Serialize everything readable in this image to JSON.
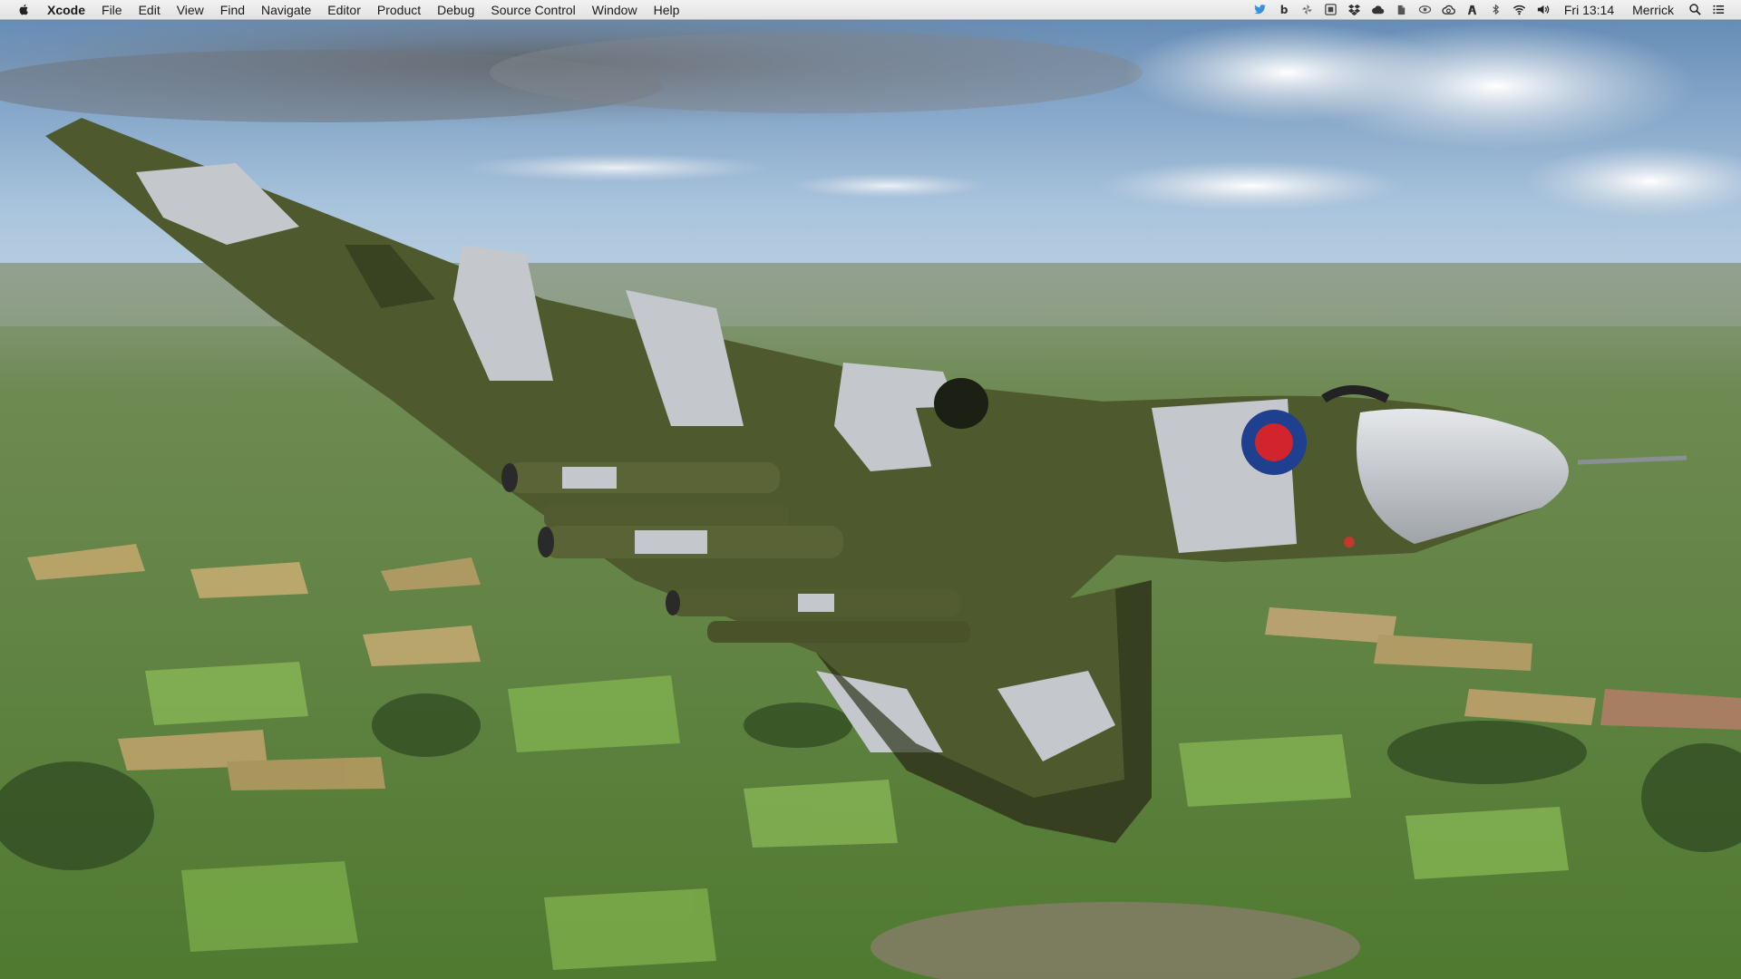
{
  "menubar": {
    "app_name": "Xcode",
    "menus": [
      "File",
      "Edit",
      "View",
      "Find",
      "Navigate",
      "Editor",
      "Product",
      "Debug",
      "Source Control",
      "Window",
      "Help"
    ],
    "status_icons": [
      "twitter-icon",
      "b-app-icon",
      "pinwheel-icon",
      "screen-capture-icon",
      "dropbox-icon",
      "cloud-icon",
      "evernote-icon",
      "eye-icon",
      "creative-cloud-icon",
      "alfred-icon",
      "bluetooth-icon",
      "wifi-icon",
      "volume-icon"
    ],
    "clock": "Fri 13:14",
    "user": "Merrick"
  },
  "desktop": {
    "wallpaper": "vulcan-bomber-over-countryside",
    "colors": {
      "sky": "#8fb4d6",
      "cloud": "#f2f4f6",
      "field": "#7aa64e",
      "camo_green": "#4e5a2e",
      "camo_grey": "#c4c8cc",
      "roundel_red": "#d1242c",
      "roundel_blue": "#1f3f8f"
    }
  }
}
